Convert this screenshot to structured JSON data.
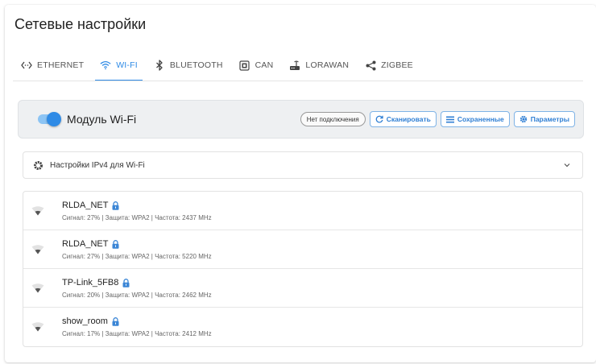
{
  "page": {
    "title": "Сетевые настройки"
  },
  "tabs": [
    {
      "label": "ETHERNET",
      "icon": "ethernet-icon",
      "active": false
    },
    {
      "label": "WI-FI",
      "icon": "wifi-icon",
      "active": true
    },
    {
      "label": "BLUETOOTH",
      "icon": "bluetooth-icon",
      "active": false
    },
    {
      "label": "CAN",
      "icon": "can-icon",
      "active": false
    },
    {
      "label": "LORAWAN",
      "icon": "router-icon",
      "active": false
    },
    {
      "label": "ZIGBEE",
      "icon": "share-icon",
      "active": false
    }
  ],
  "module": {
    "label": "Модуль Wi-Fi",
    "enabled": true,
    "status": "Нет подключения",
    "scan_label": "Сканировать",
    "saved_label": "Сохраненные",
    "params_label": "Параметры"
  },
  "ipv4": {
    "title": "Настройки IPv4 для Wi-Fi"
  },
  "networks": [
    {
      "ssid": "RLDA_NET",
      "meta": "Сигнал: 27% | Защита: WPA2 | Частота: 2437 MHz"
    },
    {
      "ssid": "RLDA_NET",
      "meta": "Сигнал: 27% | Защита: WPA2 | Частота: 5220 MHz"
    },
    {
      "ssid": "TP-Link_5FB8",
      "meta": "Сигнал: 20% | Защита: WPA2 | Частота: 2462 MHz"
    },
    {
      "ssid": "show_room",
      "meta": "Сигнал: 17% | Защита: WPA2 | Частота: 2412 MHz"
    }
  ],
  "colors": {
    "accent": "#2f8be6",
    "lock": "#3b86d6"
  }
}
